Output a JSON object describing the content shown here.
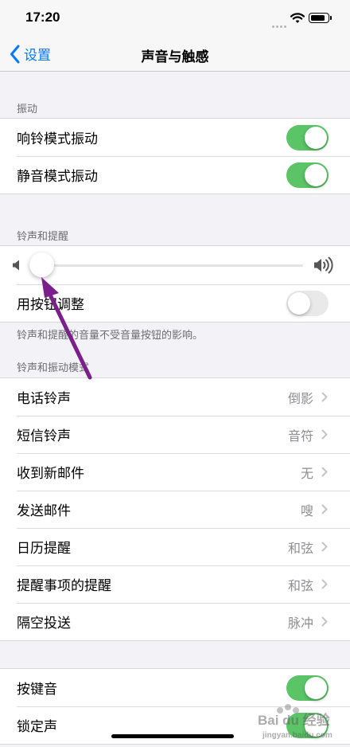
{
  "status": {
    "time": "17:20"
  },
  "nav": {
    "back_label": "设置",
    "title": "声音与触感"
  },
  "vibration": {
    "header": "振动",
    "items": [
      {
        "label": "响铃模式振动",
        "on": true
      },
      {
        "label": "静音模式振动",
        "on": true
      }
    ]
  },
  "ringer": {
    "header": "铃声和提醒",
    "volume_fraction": 0.0,
    "button_adjust": {
      "label": "用按钮调整",
      "on": false
    },
    "footer": "铃声和提醒的音量不受音量按钮的影响。"
  },
  "patterns": {
    "header": "铃声和振动模式",
    "items": [
      {
        "label": "电话铃声",
        "value": "倒影"
      },
      {
        "label": "短信铃声",
        "value": "音符"
      },
      {
        "label": "收到新邮件",
        "value": "无"
      },
      {
        "label": "发送邮件",
        "value": "嗖"
      },
      {
        "label": "日历提醒",
        "value": "和弦"
      },
      {
        "label": "提醒事项的提醒",
        "value": "和弦"
      },
      {
        "label": "隔空投送",
        "value": "脉冲"
      }
    ]
  },
  "system": {
    "items": [
      {
        "label": "按键音",
        "on": true
      },
      {
        "label": "锁定声",
        "on": true
      }
    ]
  },
  "watermark": {
    "text": "Bai du 经验",
    "sub": "jingyan.baidu.com"
  },
  "colors": {
    "accent": "#007aff",
    "switch_on": "#5ac466",
    "annotation_arrow": "#7b1f8a"
  }
}
